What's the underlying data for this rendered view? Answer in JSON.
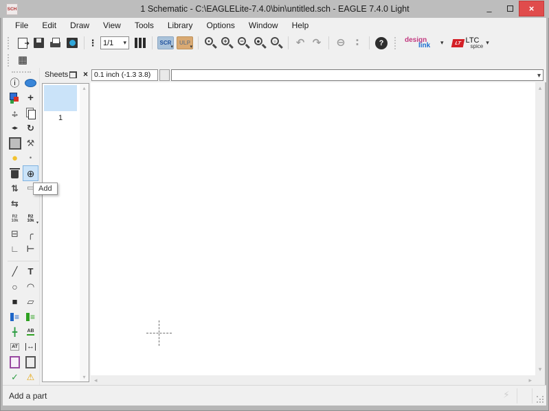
{
  "window": {
    "title": "1 Schematic - C:\\EAGLELite-7.4.0\\bin\\untitled.sch - EAGLE 7.4.0 Light",
    "app_icon_text": "SCH",
    "controls": {
      "minimize": "–",
      "close": "×"
    }
  },
  "menu": {
    "items": [
      "File",
      "Edit",
      "Draw",
      "View",
      "Tools",
      "Library",
      "Options",
      "Window",
      "Help"
    ]
  },
  "toolbar": {
    "sheet_selector": "1/1",
    "scr_label": "SCR",
    "ulp_label": "ULP",
    "zoom_signs": [
      "▪",
      "+",
      "−",
      "●",
      "▫"
    ],
    "design_link": {
      "design": "design",
      "link": "link"
    },
    "ltc": {
      "lt": "LT",
      "line1": "LTC",
      "line2": "spice"
    }
  },
  "icons": {
    "caret": "▾",
    "up": "▴",
    "down": "▾",
    "left": "◂",
    "right": "▸",
    "undo": "↶",
    "redo": "↷",
    "stop": "⊖",
    "go": "∶",
    "grid": "▦",
    "stack": "⋮",
    "help": "?",
    "lightning": "⚡"
  },
  "coordbar": {
    "coords": "0.1 inch (-1.3 3.8)"
  },
  "sheets_panel": {
    "title": "Sheets",
    "close": "×",
    "sheet_label": "1"
  },
  "tooltip": {
    "text": "Add"
  },
  "statusbar": {
    "text": "Add a part"
  },
  "palette": {
    "items": [
      {
        "name": "info",
        "glyph": "ⓘ",
        "size": 14,
        "color": "#1a1a1a"
      },
      {
        "name": "show",
        "cls": "ic-eye"
      },
      {
        "name": "display",
        "cls": "ic-display"
      },
      {
        "name": "mark",
        "glyph": "+",
        "size": 15,
        "color": "#333",
        "cls": "bold"
      },
      {
        "name": "move",
        "cls": "ic-move"
      },
      {
        "name": "copy",
        "cls": "ic-copy"
      },
      {
        "name": "mirror",
        "glyph": "◂▸",
        "size": 9,
        "color": "#333"
      },
      {
        "name": "rotate",
        "glyph": "↻",
        "size": 13,
        "color": "#333",
        "cls": "bold"
      },
      {
        "name": "group",
        "cls": "ic-group"
      },
      {
        "name": "change",
        "glyph": "⚒",
        "size": 13,
        "color": "#555"
      },
      {
        "name": "paste",
        "glyph": "●",
        "size": 15,
        "color": "#f2c230"
      },
      {
        "name": "cut",
        "glyph": "•",
        "size": 10,
        "color": "#777"
      },
      {
        "name": "delete",
        "cls": "ic-trash"
      },
      {
        "name": "add",
        "glyph": "⊕",
        "size": 14,
        "color": "#222",
        "sel": true
      },
      {
        "name": "pinswap",
        "glyph": "⇅",
        "size": 13,
        "color": "#444",
        "cls": "bold"
      },
      {
        "name": "replace",
        "glyph": "▭",
        "size": 11,
        "color": "#666"
      },
      {
        "name": "gateswap",
        "glyph": "⇆",
        "size": 13,
        "color": "#444",
        "cls": "bold"
      },
      {
        "empty": true
      },
      {
        "name": "name",
        "cls": "ic-name",
        "glyph": "R2\n10k"
      },
      {
        "name": "value",
        "cls": "ic-name ic-value",
        "glyph": "R2\n10k"
      },
      {
        "name": "smash",
        "glyph": "⊟",
        "size": 13,
        "color": "#444"
      },
      {
        "name": "miter",
        "glyph": "╭",
        "size": 14,
        "color": "#555",
        "cls": "bold"
      },
      {
        "name": "split",
        "glyph": "∟",
        "size": 13,
        "color": "#555",
        "cls": "bold"
      },
      {
        "name": "invoke",
        "glyph": "⊢",
        "size": 13,
        "color": "#555",
        "cls": "bold"
      },
      {
        "sep": true
      },
      {
        "name": "wire",
        "glyph": "╱",
        "size": 13,
        "color": "#333",
        "cls": "bold"
      },
      {
        "name": "text",
        "glyph": "T",
        "size": 13,
        "color": "#333",
        "cls": "bold"
      },
      {
        "name": "circle",
        "glyph": "○",
        "size": 14,
        "color": "#333",
        "cls": "bold"
      },
      {
        "name": "arc",
        "glyph": "◠",
        "size": 13,
        "color": "#333"
      },
      {
        "name": "rect",
        "glyph": "■",
        "size": 13,
        "color": "#2b2b2b"
      },
      {
        "name": "polygon",
        "glyph": "▱",
        "size": 13,
        "color": "#444"
      },
      {
        "name": "bus",
        "cls": "ic-bus",
        "glyph": "≡"
      },
      {
        "name": "net",
        "cls": "ic-net",
        "glyph": "≡"
      },
      {
        "name": "junction",
        "glyph": "╋",
        "size": 12,
        "color": "#2f9e44",
        "cls": "bold"
      },
      {
        "name": "label",
        "cls": "ic-label",
        "glyph": "AB"
      },
      {
        "name": "attribute",
        "cls": "ic-attr",
        "glyph": "AT"
      },
      {
        "name": "dimension",
        "cls": "ic-dim",
        "glyph": "↔"
      },
      {
        "name": "module",
        "cls": "ic-module"
      },
      {
        "name": "port",
        "cls": "ic-port"
      },
      {
        "name": "erc",
        "glyph": "✓",
        "size": 13,
        "color": "#2f9e44",
        "cls": "bold"
      },
      {
        "name": "errors",
        "glyph": "⚠",
        "size": 13,
        "color": "#e5a50a"
      }
    ]
  }
}
